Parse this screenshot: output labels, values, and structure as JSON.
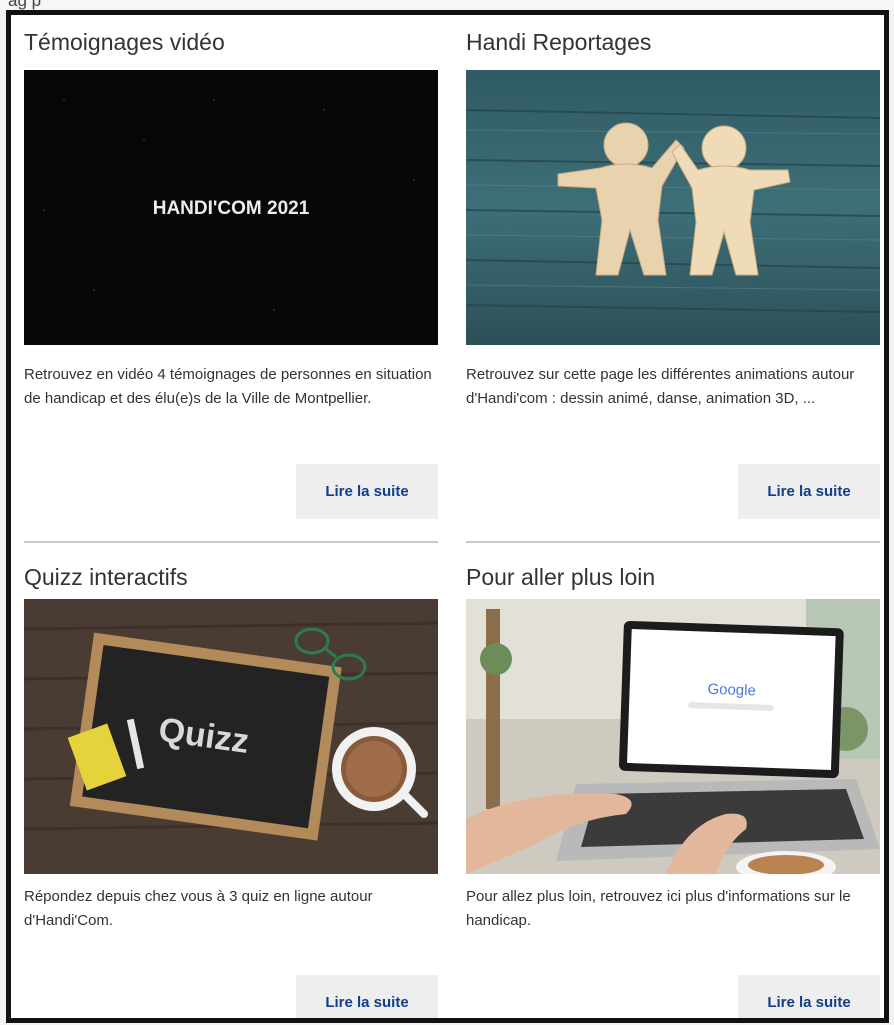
{
  "top_fragment": "ag p",
  "cards": [
    {
      "title": "Témoignages vidéo",
      "image_caption": "HANDI'COM 2021",
      "description": "Retrouvez en vidéo 4 témoignages de personnes en situation de handicap et des élu(e)s de la Ville de Montpellier.",
      "button": "Lire la suite"
    },
    {
      "title": "Handi Reportages",
      "image_caption": "",
      "description": "Retrouvez sur cette page les différentes animations autour d'Handi'com : dessin animé, danse, animation 3D, ...",
      "button": "Lire la suite"
    },
    {
      "title": "Quizz interactifs",
      "image_caption": "Quizz",
      "description": "Répondez depuis chez vous à 3 quiz en ligne autour d'Handi'Com.",
      "button": "Lire la suite"
    },
    {
      "title": "Pour aller plus loin",
      "image_caption": "Google",
      "description": "Pour allez plus loin, retrouvez ici plus d'informations sur le handicap.",
      "button": "Lire la suite"
    }
  ],
  "colors": {
    "link": "#123f86",
    "button_bg": "#eeeeee",
    "divider": "#c9c9c9"
  }
}
